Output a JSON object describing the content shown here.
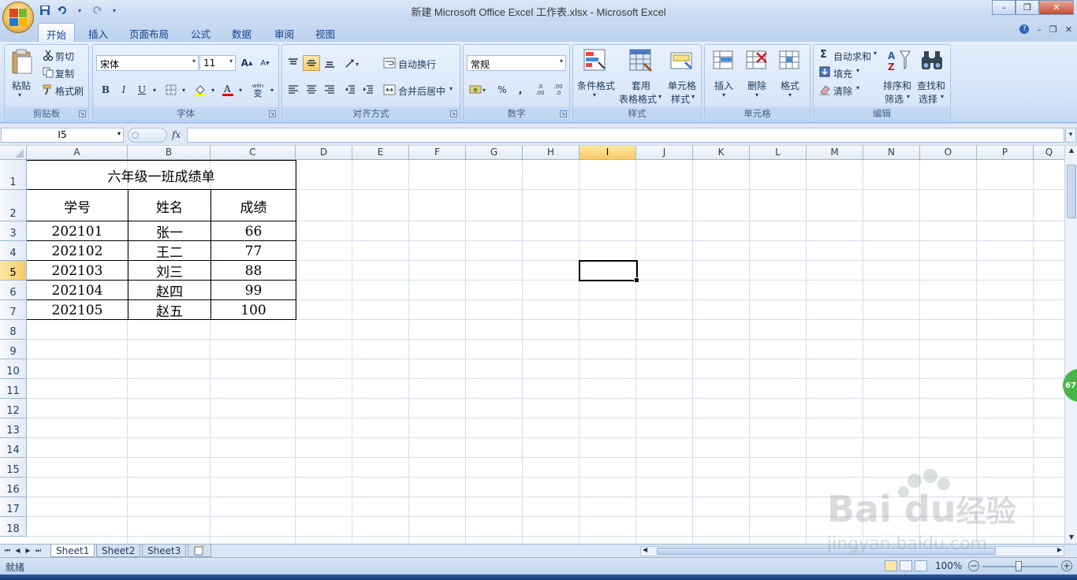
{
  "window": {
    "title": "新建 Microsoft Office Excel 工作表.xlsx - Microsoft Excel",
    "minimize_label": "–",
    "restore_label": "❐",
    "close_label": "✕"
  },
  "tabs": [
    {
      "label": "开始",
      "active": true
    },
    {
      "label": "插入"
    },
    {
      "label": "页面布局"
    },
    {
      "label": "公式"
    },
    {
      "label": "数据"
    },
    {
      "label": "审阅"
    },
    {
      "label": "视图"
    }
  ],
  "ribbon": {
    "clipboard": {
      "paste": "粘贴",
      "cut": "剪切",
      "copy": "复制",
      "format_painter": "格式刷",
      "label": "剪贴板"
    },
    "font": {
      "name": "宋体",
      "size": "11",
      "label": "字体",
      "bold": "B",
      "italic": "I",
      "underline": "U",
      "grow": "A",
      "shrink": "A",
      "wen": "wén",
      "wen_char": "变"
    },
    "alignment": {
      "wrap": "自动换行",
      "merge": "合并后居中",
      "label": "对齐方式"
    },
    "number": {
      "format": "常规",
      "percent": "%",
      "comma": ",",
      "inc_decimal": ".0 .00",
      "dec_decimal": ".00 .0",
      "label": "数字"
    },
    "styles": {
      "conditional_1": "条件格式",
      "table_1": "套用",
      "table_2": "表格格式",
      "cell_style_1": "单元格",
      "cell_style_2": "样式",
      "label": "样式"
    },
    "cells": {
      "insert": "插入",
      "delete": "删除",
      "format": "格式",
      "label": "单元格"
    },
    "editing": {
      "autosum": "自动求和",
      "sigma": "Σ",
      "fill": "填充",
      "clear": "清除",
      "sort_1": "排序和",
      "sort_2": "筛选",
      "find_1": "查找和",
      "find_2": "选择",
      "label": "编辑"
    }
  },
  "formula_bar": {
    "name_box": "I5",
    "fx": "fx",
    "value": ""
  },
  "columns": [
    "A",
    "B",
    "C",
    "D",
    "E",
    "F",
    "G",
    "H",
    "I",
    "J",
    "K",
    "L",
    "M",
    "N",
    "O",
    "P",
    "Q"
  ],
  "rows": [
    "1",
    "2",
    "3",
    "4",
    "5",
    "6",
    "7",
    "8",
    "9",
    "10",
    "11",
    "12",
    "13",
    "14",
    "15",
    "16",
    "17",
    "18"
  ],
  "selected": {
    "column": "I",
    "row": "5"
  },
  "sheet": {
    "title": "六年级一班成绩单",
    "headers": [
      "学号",
      "姓名",
      "成绩"
    ],
    "records": [
      [
        "202101",
        "张一",
        "66"
      ],
      [
        "202102",
        "王二",
        "77"
      ],
      [
        "202103",
        "刘三",
        "88"
      ],
      [
        "202104",
        "赵四",
        "99"
      ],
      [
        "202105",
        "赵五",
        "100"
      ]
    ]
  },
  "sheet_tabs": [
    {
      "label": "Sheet1",
      "active": true
    },
    {
      "label": "Sheet2"
    },
    {
      "label": "Sheet3"
    }
  ],
  "status": {
    "mode": "就绪",
    "zoom": "100%"
  },
  "watermark": {
    "brand": "Bai du",
    "brand_cn": "经验",
    "url": "jingyan.baidu.com"
  },
  "badge": "67"
}
